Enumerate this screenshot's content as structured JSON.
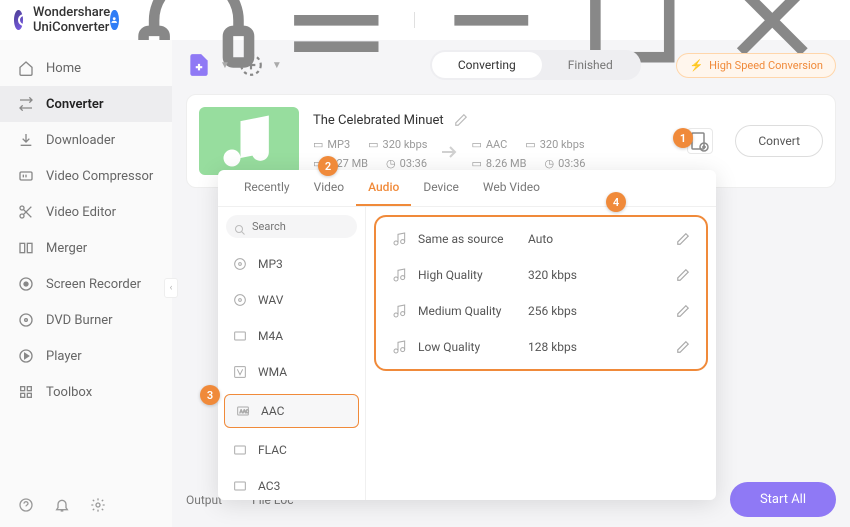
{
  "app_title": "Wondershare UniConverter",
  "titlebar_icons": {
    "headset": "headset-icon",
    "menu": "menu-icon",
    "min": "minimize-icon",
    "max": "maximize-icon",
    "close": "close-icon"
  },
  "sidebar": {
    "items": [
      {
        "label": "Home",
        "icon": "home"
      },
      {
        "label": "Converter",
        "icon": "converter"
      },
      {
        "label": "Downloader",
        "icon": "download"
      },
      {
        "label": "Video Compressor",
        "icon": "compress"
      },
      {
        "label": "Video Editor",
        "icon": "scissors"
      },
      {
        "label": "Merger",
        "icon": "merge"
      },
      {
        "label": "Screen Recorder",
        "icon": "record"
      },
      {
        "label": "DVD Burner",
        "icon": "disc"
      },
      {
        "label": "Player",
        "icon": "play"
      },
      {
        "label": "Toolbox",
        "icon": "grid"
      }
    ],
    "active_index": 1
  },
  "mode_tabs": {
    "converting": "Converting",
    "finished": "Finished",
    "active": "converting"
  },
  "high_speed": "High Speed Conversion",
  "file": {
    "name": "The Celebrated Minuet",
    "src": {
      "fmt": "MP3",
      "bitrate": "320 kbps",
      "size": "8.27 MB",
      "dur": "03:36"
    },
    "dst": {
      "fmt": "AAC",
      "bitrate": "320 kbps",
      "size": "8.26 MB",
      "dur": "03:36"
    },
    "convert_label": "Convert"
  },
  "footer": {
    "output": "Output",
    "fileloc": "File Loc",
    "startall": "Start All"
  },
  "popup": {
    "tabs": [
      "Recently",
      "Video",
      "Audio",
      "Device",
      "Web Video"
    ],
    "active_tab": 2,
    "search_placeholder": "Search",
    "formats": [
      "MP3",
      "WAV",
      "M4A",
      "WMA",
      "AAC",
      "FLAC",
      "AC3"
    ],
    "selected_format": 4,
    "qualities": [
      {
        "name": "Same as source",
        "bitrate": "Auto"
      },
      {
        "name": "High Quality",
        "bitrate": "320 kbps"
      },
      {
        "name": "Medium Quality",
        "bitrate": "256 kbps"
      },
      {
        "name": "Low Quality",
        "bitrate": "128 kbps"
      }
    ]
  },
  "badges": {
    "1": "1",
    "2": "2",
    "3": "3",
    "4": "4"
  }
}
